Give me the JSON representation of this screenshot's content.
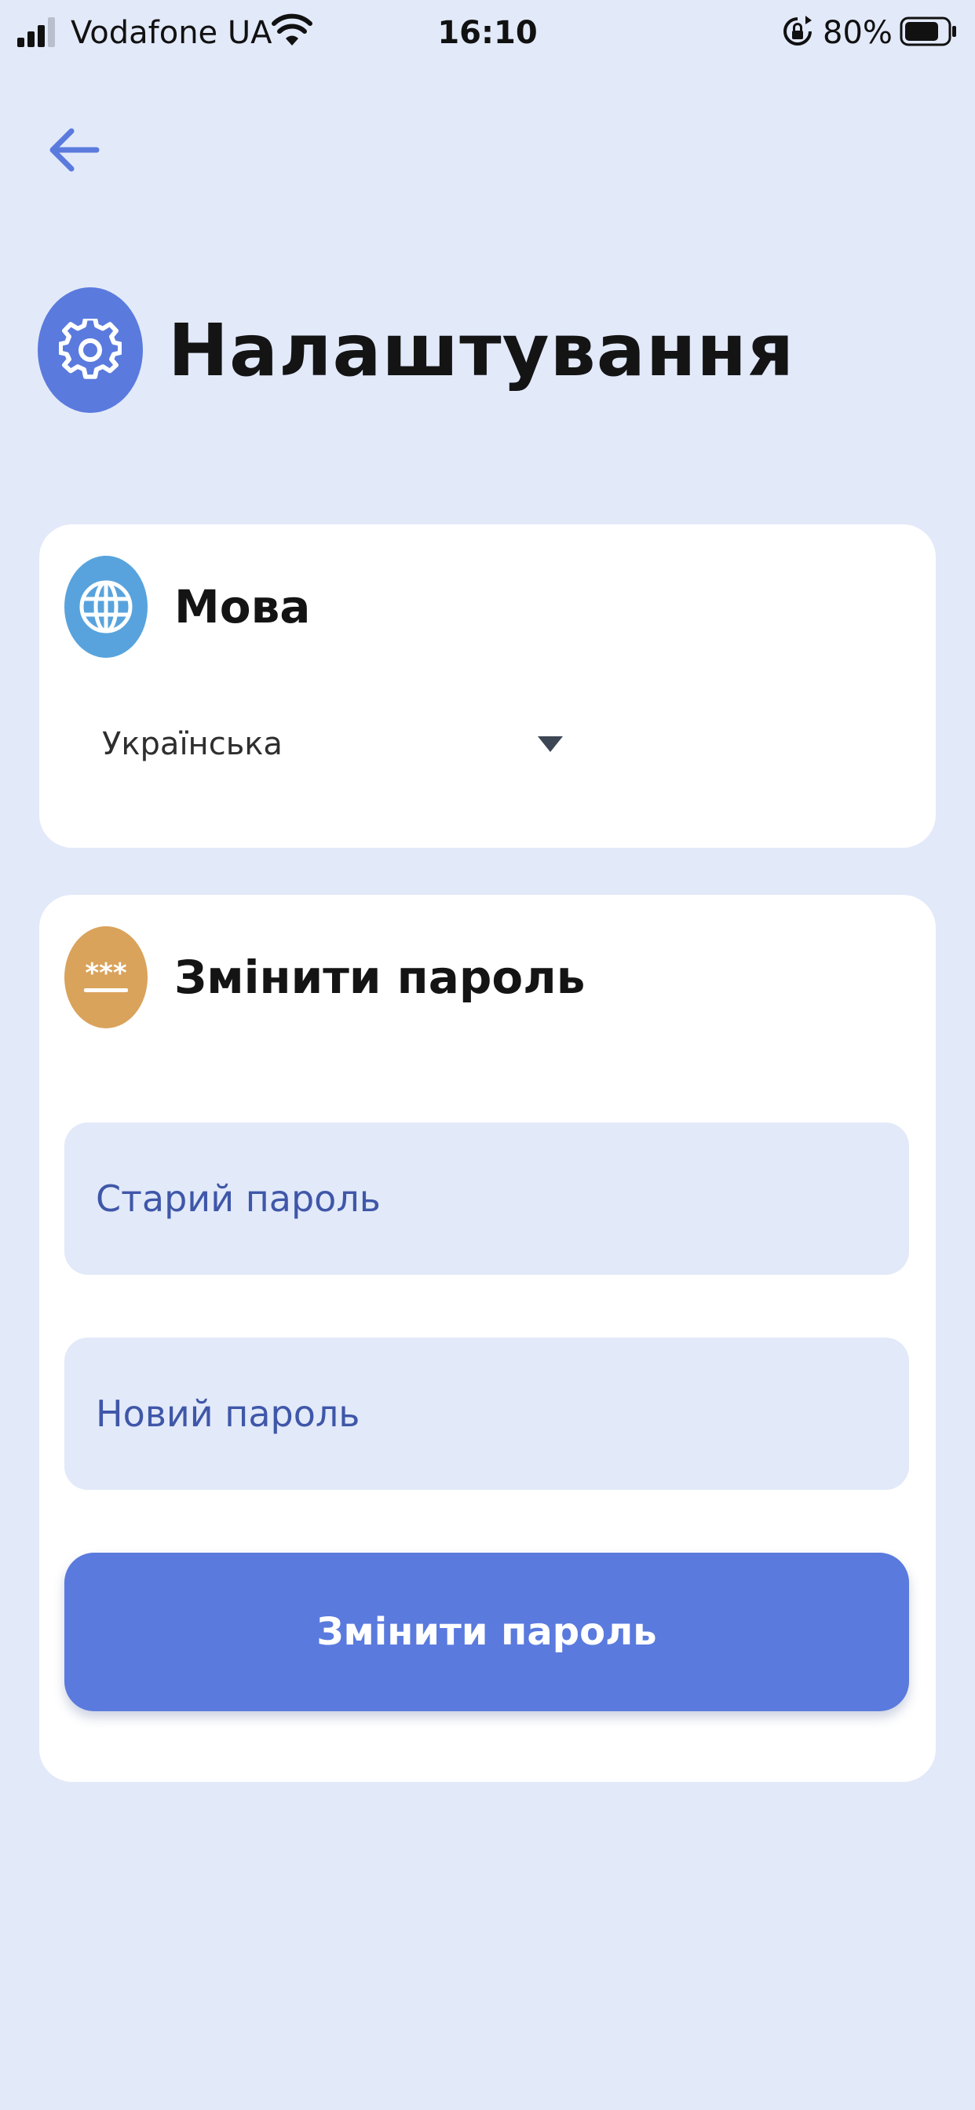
{
  "status_bar": {
    "carrier": "Vodafone UA",
    "time": "16:10",
    "battery_percent": "80%",
    "battery_level": 0.8
  },
  "header": {
    "back_icon": "arrow-left-icon",
    "title": "Налаштування",
    "title_icon": "gear-icon"
  },
  "language_section": {
    "icon": "globe-icon",
    "title": "Мова",
    "selected_language": "Українська"
  },
  "password_section": {
    "icon": "password-icon",
    "title": "Змінити пароль",
    "old_password_placeholder": "Старий пароль",
    "new_password_placeholder": "Новий пароль",
    "submit_label": "Змінити пароль"
  },
  "colors": {
    "background": "#e2e9f9",
    "accent": "#5a7ade",
    "globe_icon_bg": "#58a3dd",
    "password_icon_bg": "#d9a35b",
    "card_bg": "#ffffff"
  }
}
